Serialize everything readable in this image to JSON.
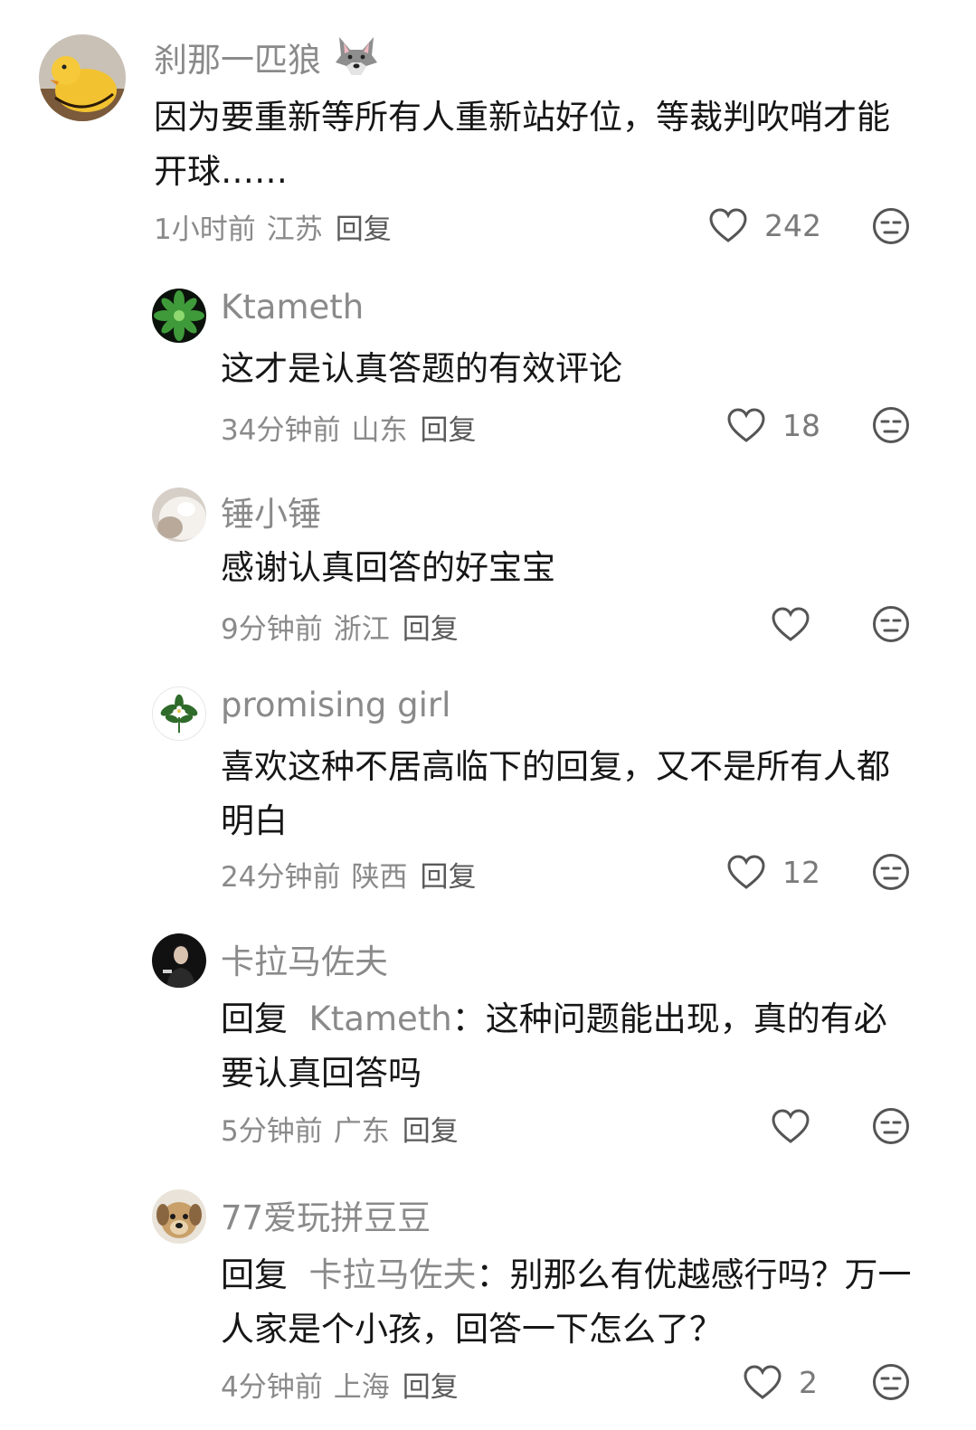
{
  "comments": [
    {
      "username": "刹那一匹狼",
      "badge_icon": "wolf-emoji-icon",
      "avatar_icon": "yellow-bird-plush-avatar",
      "text": "因为要重新等所有人重新站好位，等裁判吹哨才能开球……",
      "time": "1小时前",
      "location": "江苏",
      "reply_label": "回复",
      "likes": "242"
    },
    {
      "username": "Ktameth",
      "avatar_icon": "green-leaves-avatar",
      "text": "这才是认真答题的有效评论",
      "time": "34分钟前",
      "location": "山东",
      "reply_label": "回复",
      "likes": "18"
    },
    {
      "username": "锤小锤",
      "avatar_icon": "white-cat-avatar",
      "text": "感谢认真回答的好宝宝",
      "time": "9分钟前",
      "location": "浙江",
      "reply_label": "回复",
      "likes": ""
    },
    {
      "username": "promising girl",
      "avatar_icon": "flower-bouquet-avatar",
      "text": "喜欢这种不居高临下的回复，又不是所有人都明白",
      "time": "24分钟前",
      "location": "陕西",
      "reply_label": "回复",
      "likes": "12"
    },
    {
      "username": "卡拉马佐夫",
      "avatar_icon": "dark-portrait-avatar",
      "reply_prefix": "回复",
      "reply_to": "Ktameth",
      "text": "：这种问题能出现，真的有必要认真回答吗",
      "time": "5分钟前",
      "location": "广东",
      "reply_label": "回复",
      "likes": ""
    },
    {
      "username": "77爱玩拼豆豆",
      "avatar_icon": "puppy-avatar",
      "reply_prefix": "回复",
      "reply_to": "卡拉马佐夫",
      "text": "：别那么有优越感行吗？万一人家是个小孩，回答一下怎么了？",
      "time": "4分钟前",
      "location": "上海",
      "reply_label": "回复",
      "likes": "2"
    }
  ],
  "icons": {
    "like": "heart-outline-icon",
    "dislike": "unamused-face-icon"
  },
  "colors": {
    "text": "#161616",
    "muted": "#8a8a8a",
    "icon": "#555555"
  }
}
